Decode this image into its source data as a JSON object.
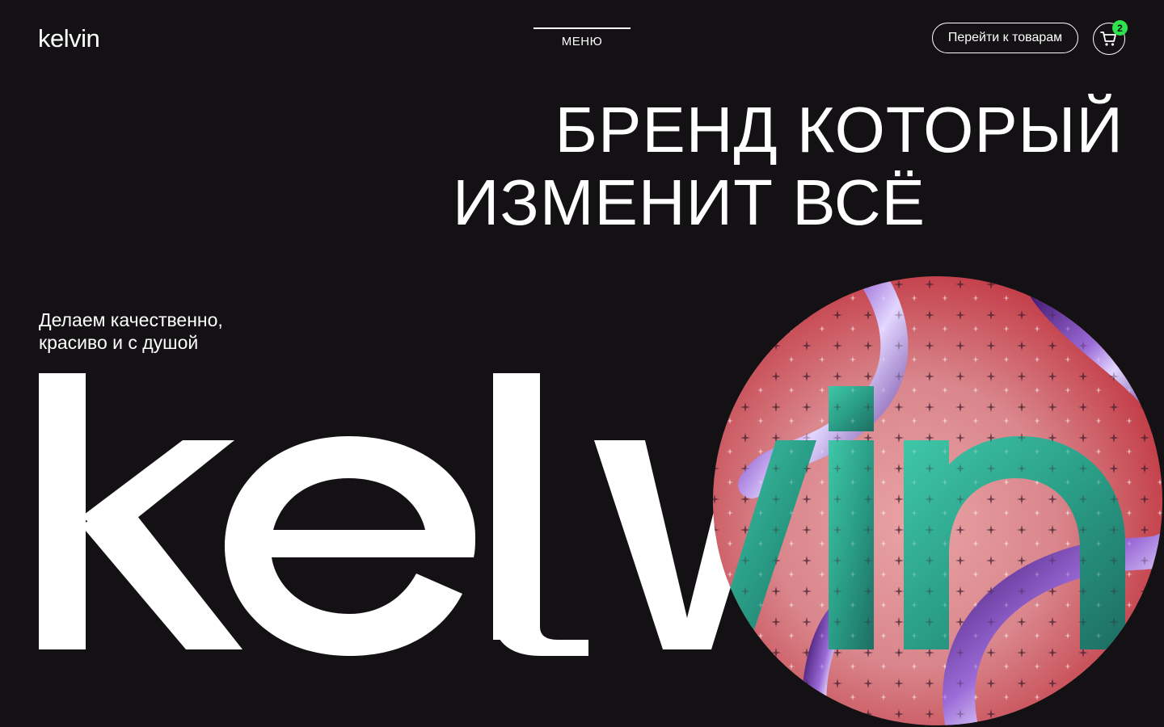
{
  "header": {
    "logo": "kelvin",
    "menu_label": "МЕНЮ",
    "goto_label": "Перейти к товарам",
    "cart_icon": "cart-icon",
    "cart_count": "2"
  },
  "hero": {
    "title_line1": "БРЕНД КОТОРЫЙ",
    "title_line2": "ИЗМЕНИТ ВСЁ",
    "tagline_line1": "Делаем качественно,",
    "tagline_line2": "красиво и с душой",
    "big_wordmark": "kelvin"
  },
  "colors": {
    "background": "#131113",
    "text": "#ffffff",
    "badge": "#2ee34c",
    "art_pink": "#d9868c",
    "art_red": "#c4404a",
    "art_teal": "#2a9e86",
    "art_purple": "#7a3fa8"
  }
}
